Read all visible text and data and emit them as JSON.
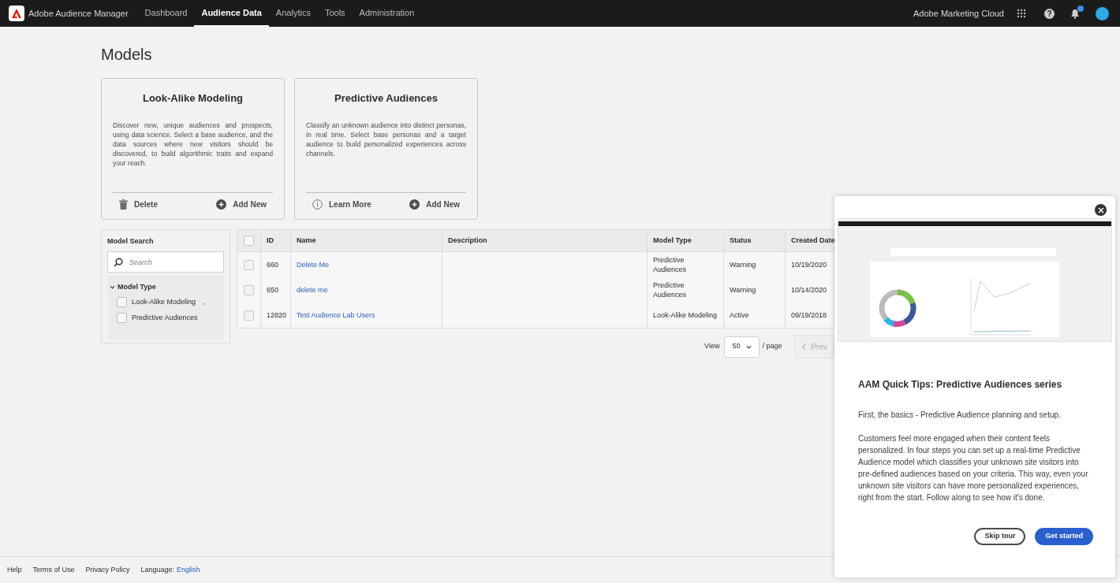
{
  "topbar": {
    "product": "Adobe Audience Manager",
    "nav": [
      {
        "label": "Dashboard",
        "selected": false
      },
      {
        "label": "Audience Data",
        "selected": true
      },
      {
        "label": "Analytics",
        "selected": false
      },
      {
        "label": "Tools",
        "selected": false
      },
      {
        "label": "Administration",
        "selected": false
      }
    ],
    "cloud": "Adobe Marketing Cloud",
    "notification_badge": true,
    "help_glyph": "?"
  },
  "page_title": "Models",
  "cards": [
    {
      "title": "Look-Alike Modeling",
      "description": "Discover new, unique audiences and prospects, using data science. Select a base audience, and the data sources where new visitors should be discovered, to build algorithmic traits and expand your reach.",
      "actions": [
        {
          "kind": "delete",
          "label": "Delete"
        },
        {
          "kind": "add",
          "label": "Add New"
        }
      ]
    },
    {
      "title": "Predictive Audiences",
      "description": "Classify an unknown audience into distinct personas, in real time. Select base personas and a target audience to build personalized experiences across channels.",
      "actions": [
        {
          "kind": "info",
          "label": "Learn More"
        },
        {
          "kind": "add",
          "label": "Add New"
        }
      ]
    }
  ],
  "filter": {
    "title": "Model Search",
    "search": {
      "placeholder": "Search"
    },
    "group": {
      "label": "Model Type",
      "expanded": true,
      "options": [
        {
          "label": "Look-Alike Modeling",
          "mark": ",",
          "checked": false
        },
        {
          "label": "Predictive Audiences",
          "checked": false
        }
      ]
    }
  },
  "table": {
    "select_all": {
      "checked": false
    },
    "columns": [
      "ID",
      "Name",
      "Description",
      "Model Type",
      "Status",
      "Created Date"
    ],
    "rows": [
      {
        "checked": false,
        "id": "660",
        "name": "Delete Me",
        "description": "",
        "model_type": "Predictive Audiences",
        "status": "Warning",
        "created": "10/19/2020"
      },
      {
        "checked": false,
        "id": "650",
        "name": "delete me",
        "description": "",
        "model_type": "Predictive Audiences",
        "status": "Warning",
        "created": "10/14/2020"
      },
      {
        "checked": false,
        "id": "12820",
        "name": "Test Audience Lab Users",
        "description": "",
        "model_type": "Look-Alike Modeling",
        "status": "Active",
        "created": "09/19/2018"
      }
    ]
  },
  "pagination": {
    "view_label": "View",
    "page_size": "50",
    "per_page": "/ page",
    "prev": "Prev",
    "prev_disabled": true
  },
  "tour": {
    "title": "AAM Quick Tips: Predictive Audiences series",
    "paragraphs": [
      "First, the basics - Predictive Audience planning and setup.",
      "Customers feel more engaged when their content feels personalized. In four steps you can set up a real-time Predictive Audience model which classifies your unknown site visitors into pre-defined audiences based on your criteria. This way, even your unknown site visitors can have more personalized experiences, right from the start. Follow along to see how it's done."
    ],
    "buttons": [
      {
        "kind": "secondary",
        "label": "Skip tour"
      },
      {
        "kind": "primary",
        "label": "Get started"
      }
    ]
  },
  "footer": {
    "links": [
      "Help",
      "Terms of Use",
      "Privacy Policy"
    ],
    "language_label": "Language:",
    "language": "English"
  }
}
